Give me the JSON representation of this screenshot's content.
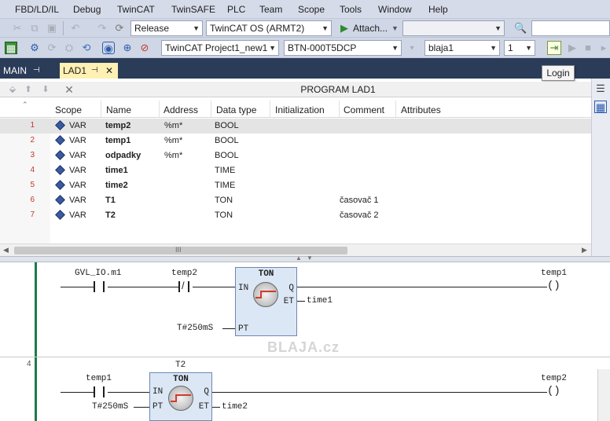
{
  "menu": {
    "items": [
      "FBD/LD/IL",
      "Debug",
      "TwinCAT",
      "TwinSAFE",
      "PLC",
      "Team",
      "Scope",
      "Tools",
      "Window",
      "Help"
    ]
  },
  "toolbar1": {
    "configuration": "Release",
    "platform": "TwinCAT OS (ARMT2)",
    "attach_label": "Attach..."
  },
  "toolbar2": {
    "project": "TwinCAT Project1_new1",
    "target": "BTN-000T5DCP",
    "plc_project": "blaja1",
    "port": "1"
  },
  "tabs": {
    "main": "MAIN",
    "lad1": "LAD1"
  },
  "tooltip": "Login",
  "editor": {
    "title": "PROGRAM LAD1",
    "columns": [
      "Scope",
      "Name",
      "Address",
      "Data type",
      "Initialization",
      "Comment",
      "Attributes"
    ],
    "rows": [
      {
        "num": "1",
        "scope": "VAR",
        "name": "temp2",
        "address": "%m*",
        "type": "BOOL",
        "comment": ""
      },
      {
        "num": "2",
        "scope": "VAR",
        "name": "temp1",
        "address": "%m*",
        "type": "BOOL",
        "comment": ""
      },
      {
        "num": "3",
        "scope": "VAR",
        "name": "odpadky",
        "address": "%m*",
        "type": "BOOL",
        "comment": ""
      },
      {
        "num": "4",
        "scope": "VAR",
        "name": "time1",
        "address": "",
        "type": "TIME",
        "comment": ""
      },
      {
        "num": "5",
        "scope": "VAR",
        "name": "time2",
        "address": "",
        "type": "TIME",
        "comment": ""
      },
      {
        "num": "6",
        "scope": "VAR",
        "name": "T1",
        "address": "",
        "type": "TON",
        "comment": "časovač 1"
      },
      {
        "num": "7",
        "scope": "VAR",
        "name": "T2",
        "address": "",
        "type": "TON",
        "comment": "časovač 2"
      }
    ],
    "scroll_thumb": "III"
  },
  "ladder": {
    "net3": {
      "contact1": "GVL_IO.m1",
      "contact2": "temp2",
      "fb_type": "TON",
      "pin_in": "IN",
      "pin_pt": "PT",
      "pin_q": "Q",
      "pin_et": "ET",
      "pt_value": "T#250mS",
      "et_var": "time1",
      "coil": "temp1"
    },
    "net4": {
      "number": "4",
      "instance": "T2",
      "contact1": "temp1",
      "fb_type": "TON",
      "pin_in": "IN",
      "pin_pt": "PT",
      "pin_q": "Q",
      "pin_et": "ET",
      "pt_value": "T#250mS",
      "et_var": "time2",
      "coil": "temp2"
    },
    "watermark": "BLAJA.cz"
  }
}
